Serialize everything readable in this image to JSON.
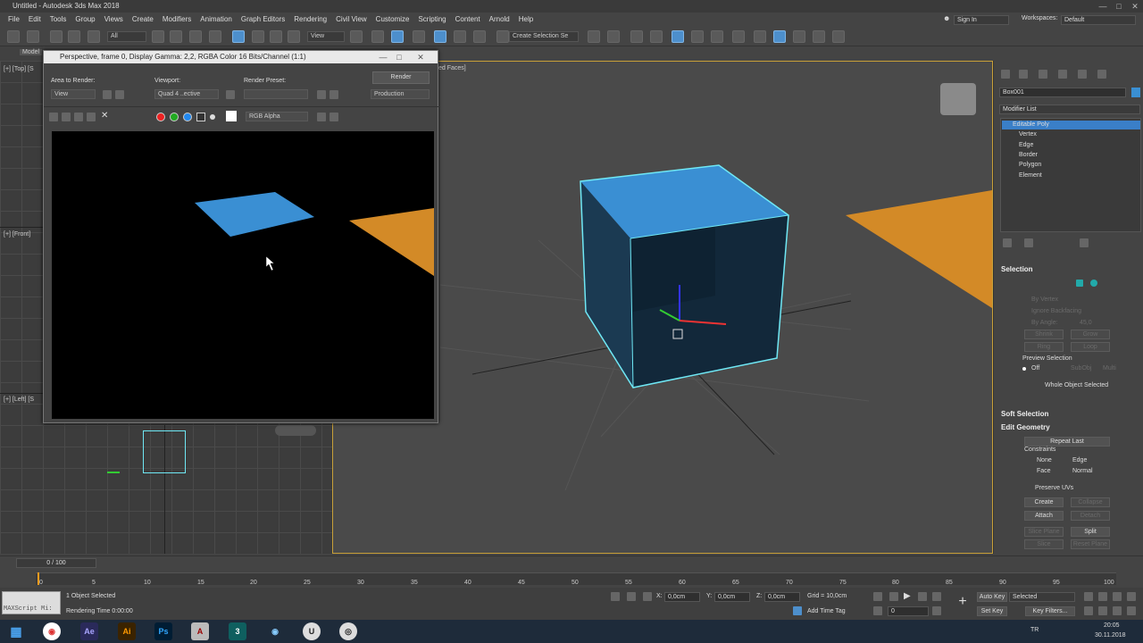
{
  "window": {
    "title": "Untitled - Autodesk 3ds Max 2018",
    "sign_in": "Sign In",
    "workspaces_label": "Workspaces:",
    "workspace": "Default"
  },
  "menu": [
    "File",
    "Edit",
    "Tools",
    "Group",
    "Views",
    "Create",
    "Modifiers",
    "Animation",
    "Graph Editors",
    "Rendering",
    "Civil View",
    "Customize",
    "Scripting",
    "Content",
    "Arnold",
    "Help"
  ],
  "toolbar": {
    "filter": "All",
    "ref_coord": "View",
    "selection_set": "Create Selection Se"
  },
  "viewports": {
    "top_label": "[+] [Top] [S",
    "front_label": "[+] [Front]",
    "left_label": "[+] [Left] [S",
    "persp_label": "ed Faces]",
    "model_tab": "Model"
  },
  "render_window": {
    "title": "Perspective, frame 0, Display Gamma: 2,2, RGBA Color 16 Bits/Channel (1:1)",
    "area_label": "Area to Render:",
    "area_value": "View",
    "viewport_label": "Viewport:",
    "viewport_value": "Quad 4 ..ective",
    "preset_label": "Render Preset:",
    "preset_value": "",
    "render_button": "Render",
    "production": "Production",
    "channel": "RGB Alpha"
  },
  "command_panel": {
    "object_name": "Box001",
    "modifier_list": "Modifier List",
    "stack": [
      "Editable Poly",
      "Vertex",
      "Edge",
      "Border",
      "Polygon",
      "Element"
    ],
    "selection_title": "Selection",
    "by_vertex": "By Vertex",
    "ignore_backfacing": "Ignore Backfacing",
    "by_angle": "By Angle:",
    "by_angle_value": "45,0",
    "shrink": "Shrink",
    "grow": "Grow",
    "ring": "Ring",
    "loop": "Loop",
    "preview_selection": "Preview Selection",
    "off": "Off",
    "subobj": "SubObj",
    "multi": "Multi",
    "whole_object": "Whole Object Selected",
    "soft_selection": "Soft Selection",
    "edit_geometry": "Edit Geometry",
    "repeat_last": "Repeat Last",
    "constraints": "Constraints",
    "none": "None",
    "edge": "Edge",
    "face": "Face",
    "normal": "Normal",
    "preserve_uvs": "Preserve UVs",
    "create": "Create",
    "collapse": "Collapse",
    "attach": "Attach",
    "detach": "Detach",
    "slice_plane": "Slice Plane",
    "split": "Split",
    "slice": "Slice",
    "reset_plane": "Reset Plane"
  },
  "timeline": {
    "frame": "0 / 100",
    "ticks": [
      "0",
      "5",
      "10",
      "15",
      "20",
      "25",
      "30",
      "35",
      "40",
      "45",
      "50",
      "55",
      "60",
      "65",
      "70",
      "75",
      "80",
      "85",
      "90",
      "95",
      "100"
    ]
  },
  "status": {
    "script": "MAXScript Mi:",
    "selected": "1 Object Selected",
    "render_time": "Rendering Time  0:00:00",
    "x_label": "X:",
    "x": "0,0cm",
    "y_label": "Y:",
    "y": "0,0cm",
    "z_label": "Z:",
    "z": "0,0cm",
    "grid": "Grid = 10,0cm",
    "add_time_tag": "Add Time Tag",
    "auto_key": "Auto Key",
    "set_key": "Set Key",
    "key_mode": "Selected",
    "key_filters": "Key Filters...",
    "frame_value": "0"
  },
  "taskbar": {
    "lang": "TR",
    "time": "20:05",
    "date": "30.11.2018"
  }
}
